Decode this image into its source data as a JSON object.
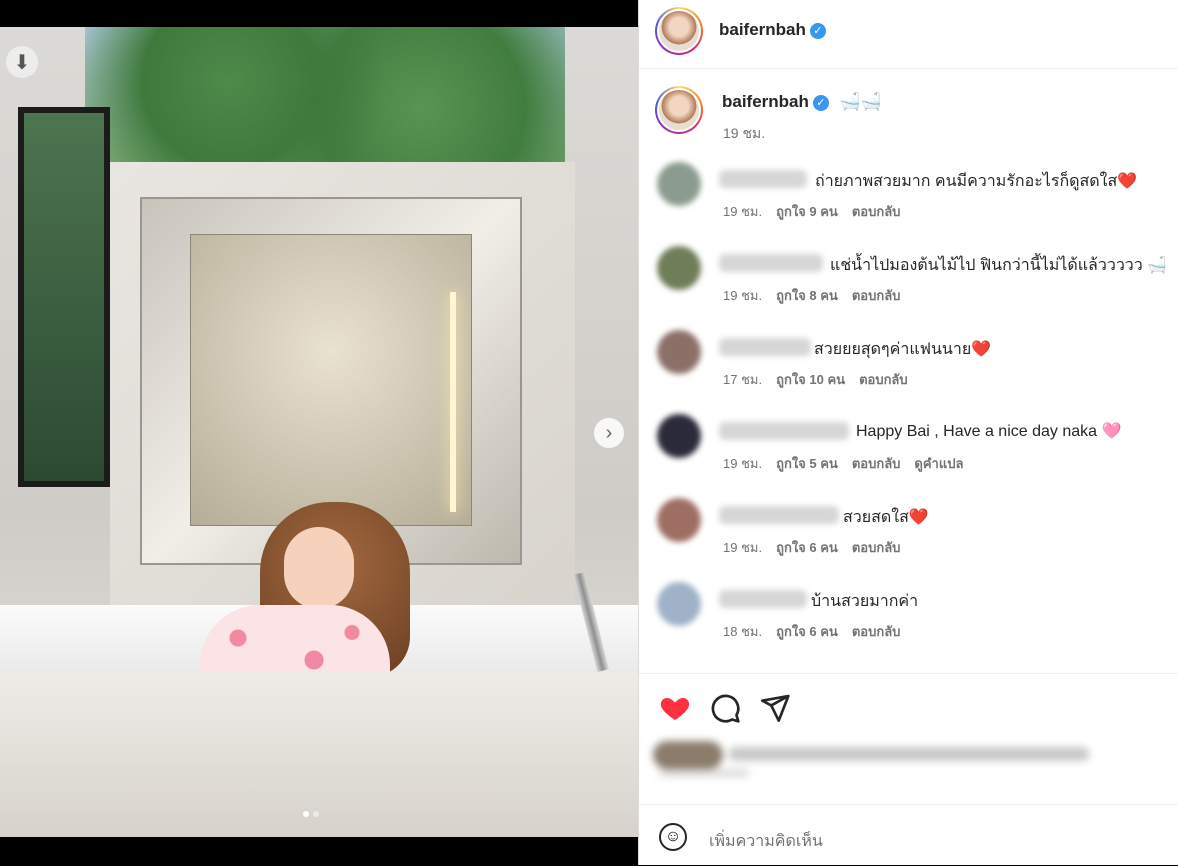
{
  "post": {
    "username": "baifernbah",
    "verified_icon": "verified-badge-icon",
    "caption_emoji": "🛁🛁",
    "caption_time": "19 ชม."
  },
  "comments": [
    {
      "text": "ถ่ายภาพสวยมาก คนมีความรักอะไรก็ดูสดใส❤️",
      "time": "19 ชม.",
      "likes": "ถูกใจ 9 คน",
      "reply": "ตอบกลับ",
      "translate": ""
    },
    {
      "text": "แช่น้ำไปมองต้นไม้ไป ฟินกว่านี้ไม่ได้แล้ววววว 🛁",
      "time": "19 ชม.",
      "likes": "ถูกใจ 8 คน",
      "reply": "ตอบกลับ",
      "translate": ""
    },
    {
      "text": "สวยยยสุดๆค่าแฟนนาย❤️",
      "time": "17 ชม.",
      "likes": "ถูกใจ 10 คน",
      "reply": "ตอบกลับ",
      "translate": ""
    },
    {
      "text": "Happy Bai , Have a nice day naka 🩷",
      "time": "19 ชม.",
      "likes": "ถูกใจ 5 คน",
      "reply": "ตอบกลับ",
      "translate": "ดูคำแปล"
    },
    {
      "text": "สวยสดใส❤️",
      "time": "19 ชม.",
      "likes": "ถูกใจ 6 คน",
      "reply": "ตอบกลับ",
      "translate": ""
    },
    {
      "text": "บ้านสวยมากค่า",
      "time": "18 ชม.",
      "likes": "ถูกใจ 6 คน",
      "reply": "ตอบกลับ",
      "translate": ""
    }
  ],
  "actions": {
    "like_icon": "heart-filled-icon",
    "comment_icon": "comment-bubble-icon",
    "share_icon": "paper-plane-icon",
    "like_color": "#ff3040"
  },
  "add_comment": {
    "placeholder": "เพิ่มความคิดเห็น",
    "emoji_icon": "smiley-icon"
  },
  "media": {
    "download_icon": "download-arrow-icon",
    "next_icon": "chevron-right-icon",
    "carousel_count": 2,
    "carousel_active": 1
  }
}
